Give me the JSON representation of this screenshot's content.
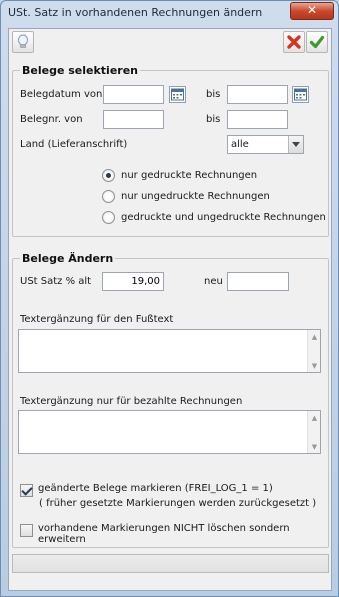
{
  "window": {
    "title": "USt. Satz in vorhandenen Rechnungen ändern",
    "close_glyph": "✕"
  },
  "toolbar": {
    "help_icon": "lightbulb-icon",
    "cancel_icon": "red-x-icon",
    "ok_icon": "green-check-icon"
  },
  "select_group": {
    "title": "Belege selektieren",
    "belegdatum_label": "Belegdatum von",
    "belegdatum_from": "",
    "belegdatum_to": "",
    "bis_label_1": "bis",
    "belegnr_label": "Belegnr. von",
    "belegnr_from": "",
    "belegnr_to": "",
    "bis_label_2": "bis",
    "land_label": "Land (Lieferanschrift)",
    "land_value": "alle",
    "radios": [
      {
        "label": "nur gedruckte Rechnungen",
        "checked": true
      },
      {
        "label": "nur ungedruckte Rechnungen",
        "checked": false
      },
      {
        "label": "gedruckte und ungedruckte Rechnungen",
        "checked": false
      }
    ]
  },
  "change_group": {
    "title": "Belege Ändern",
    "ust_alt_label": "USt Satz % alt",
    "ust_alt_value": "19,00",
    "neu_label": "neu",
    "ust_neu_value": "",
    "footer_text_label": "Textergänzung für den Fußtext",
    "footer_text_value": "",
    "paid_text_label": "Textergänzung nur für bezahlte Rechnungen",
    "paid_text_value": "",
    "mark_checkbox_label": "geänderte Belege markieren (FREI_LOG_1 = 1)",
    "mark_checkbox_note": "( früher gesetzte Markierungen werden zurückgesetzt )",
    "mark_checked": true,
    "extend_checkbox_label": "vorhandene Markierungen NICHT löschen sondern erweitern",
    "extend_checked": false
  },
  "colors": {
    "accent_red": "#d9341f",
    "accent_green": "#3c9b2a",
    "title_blue": "#b9cce2"
  }
}
